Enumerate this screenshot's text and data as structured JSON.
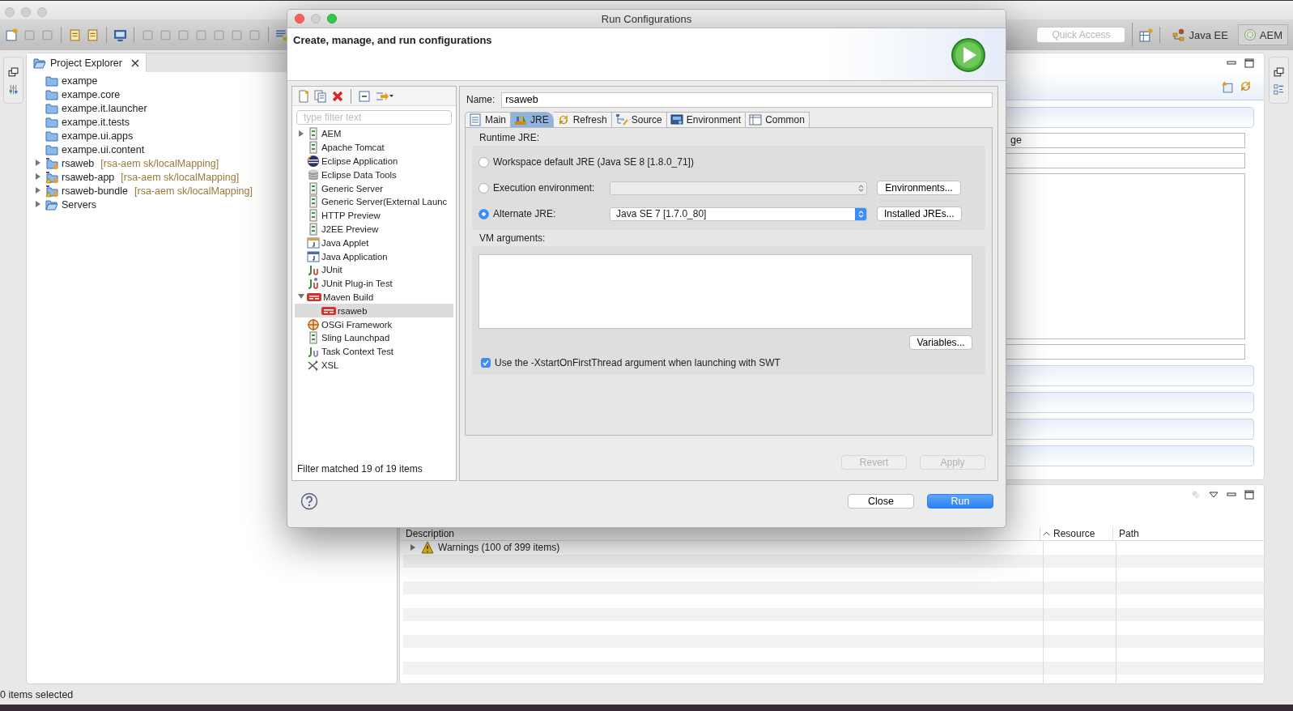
{
  "toolbar": {
    "quick_access_placeholder": "Quick Access"
  },
  "perspectives": [
    {
      "label": "Java EE",
      "selected": false
    },
    {
      "label": "AEM",
      "selected": true
    }
  ],
  "project_explorer": {
    "title": "Project Explorer",
    "items": [
      {
        "label": "exampe",
        "kind": "folder"
      },
      {
        "label": "exampe.core",
        "kind": "folder"
      },
      {
        "label": "exampe.it.launcher",
        "kind": "folder"
      },
      {
        "label": "exampe.it.tests",
        "kind": "folder"
      },
      {
        "label": "exampe.ui.apps",
        "kind": "folder"
      },
      {
        "label": "exampe.ui.content",
        "kind": "folder"
      },
      {
        "label": "rsaweb",
        "tag": "[rsa-aem sk/localMapping]",
        "kind": "project",
        "expanded": false
      },
      {
        "label": "rsaweb-app",
        "tag": "[rsa-aem sk/localMapping]",
        "kind": "project-warning",
        "expanded": false
      },
      {
        "label": "rsaweb-bundle",
        "tag": "[rsa-aem sk/localMapping]",
        "kind": "project-warning",
        "expanded": false
      },
      {
        "label": "Servers",
        "kind": "open-folder",
        "expanded": false
      }
    ]
  },
  "editor": {
    "field_value": "ge"
  },
  "problems": {
    "columns": [
      "Description",
      "Resource",
      "Path"
    ],
    "rows": [
      {
        "description": "Warnings (100 of 399 items)",
        "expanded": false
      }
    ]
  },
  "status_bar": "0 items selected",
  "dialog": {
    "title": "Run Configurations",
    "header": "Create, manage, and run configurations",
    "config_tree": {
      "filter_placeholder": "type filter text",
      "items": [
        {
          "label": "AEM",
          "kind": "server",
          "expanded": false,
          "selected": false
        },
        {
          "label": "Apache Tomcat",
          "kind": "server",
          "selected": false
        },
        {
          "label": "Eclipse Application",
          "kind": "eclipse",
          "selected": false
        },
        {
          "label": "Eclipse Data Tools",
          "kind": "database",
          "selected": false
        },
        {
          "label": "Generic Server",
          "kind": "server",
          "selected": false
        },
        {
          "label": "Generic Server(External Launc",
          "kind": "server",
          "selected": false
        },
        {
          "label": "HTTP Preview",
          "kind": "server",
          "selected": false
        },
        {
          "label": "J2EE Preview",
          "kind": "server",
          "selected": false
        },
        {
          "label": "Java Applet",
          "kind": "applet",
          "selected": false
        },
        {
          "label": "Java Application",
          "kind": "application",
          "selected": false
        },
        {
          "label": "JUnit",
          "kind": "junit",
          "selected": false
        },
        {
          "label": "JUnit Plug-in Test",
          "kind": "junit-plugin",
          "selected": false
        },
        {
          "label": "Maven Build",
          "kind": "maven",
          "expanded": true,
          "selected": false,
          "children": [
            {
              "label": "rsaweb",
              "kind": "maven",
              "selected": true
            }
          ]
        },
        {
          "label": "OSGi Framework",
          "kind": "osgi",
          "selected": false
        },
        {
          "label": "Sling Launchpad",
          "kind": "server",
          "selected": false
        },
        {
          "label": "Task Context Test",
          "kind": "task",
          "selected": false
        },
        {
          "label": "XSL",
          "kind": "xsl",
          "selected": false
        }
      ],
      "status": "Filter matched 19 of 19 items"
    },
    "name": {
      "label": "Name:",
      "value": "rsaweb"
    },
    "tabs": [
      {
        "label": "Main",
        "selected": false
      },
      {
        "label": "JRE",
        "selected": true
      },
      {
        "label": "Refresh",
        "selected": false
      },
      {
        "label": "Source",
        "selected": false
      },
      {
        "label": "Environment",
        "selected": false
      },
      {
        "label": "Common",
        "selected": false
      }
    ],
    "runtime_jre": {
      "label": "Runtime JRE:",
      "options": [
        {
          "label": "Workspace default JRE (Java SE 8 [1.8.0_71])",
          "selected": false
        },
        {
          "label": "Execution environment:",
          "selected": false,
          "dropdown": {
            "disabled": true
          },
          "button": "Environments..."
        },
        {
          "label": "Alternate JRE:",
          "selected": true,
          "dropdown": {
            "value": "Java SE 7 [1.7.0_80]",
            "disabled": false
          },
          "button": "Installed JREs..."
        }
      ]
    },
    "vm_arguments": {
      "label": "VM arguments:",
      "button": "Variables..."
    },
    "xstart_option": {
      "label": "Use the -XstartOnFirstThread argument when launching with SWT",
      "checked": true
    },
    "action_buttons": [
      {
        "label": "Revert",
        "disabled": true
      },
      {
        "label": "Apply",
        "disabled": true
      }
    ],
    "footer_buttons": [
      {
        "label": "Close",
        "default": false
      },
      {
        "label": "Run",
        "default": true
      }
    ]
  }
}
